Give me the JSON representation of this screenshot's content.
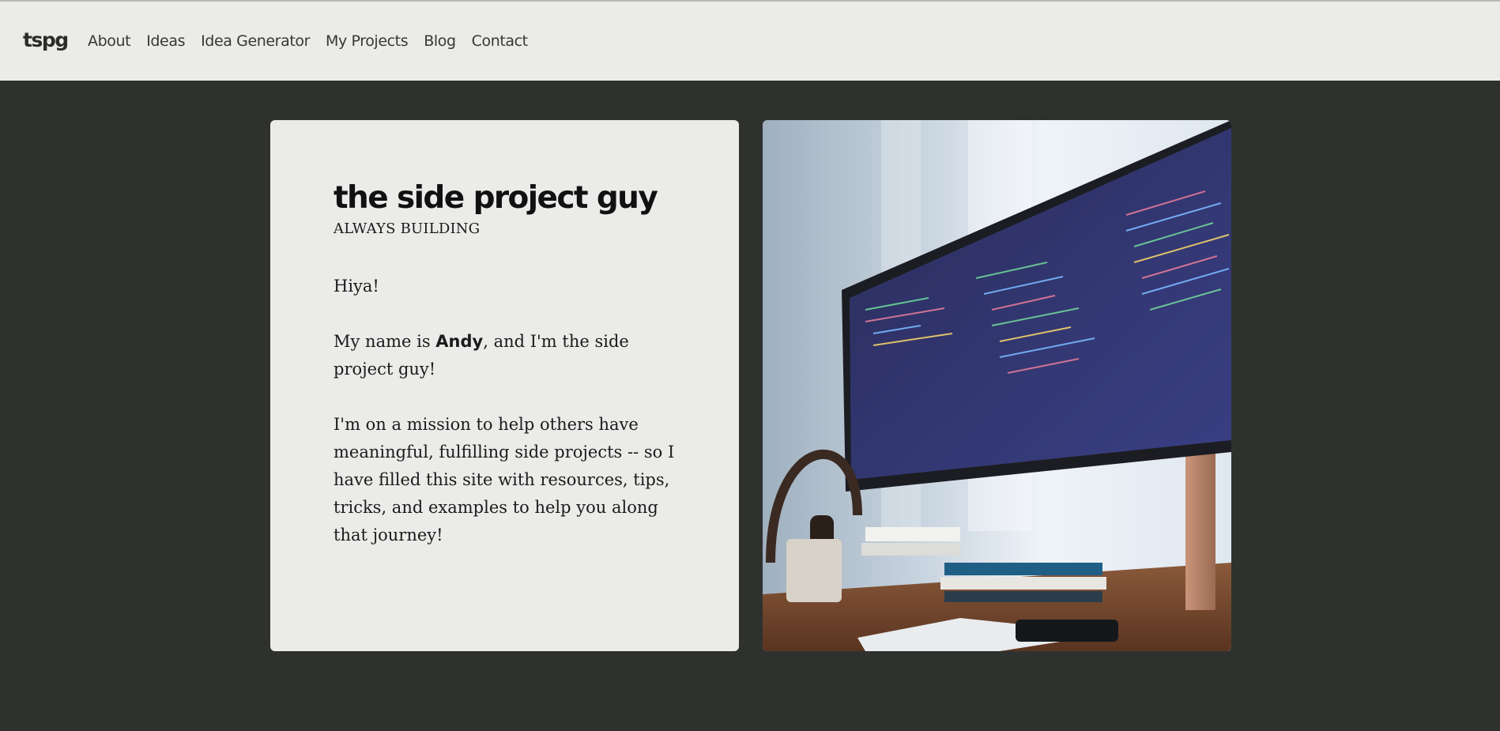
{
  "nav": {
    "brand": "tspg",
    "links": [
      "About",
      "Ideas",
      "Idea Generator",
      "My Projects",
      "Blog",
      "Contact"
    ]
  },
  "hero": {
    "title": "the side project guy",
    "subtitle": "ALWAYS BUILDING",
    "greeting": "Hiya!",
    "intro_prefix": "My name is ",
    "intro_name": "Andy",
    "intro_suffix": ", and I'm the side project guy!",
    "mission": "I'm on a mission to help others have meaningful, fulfilling side projects -- so I have filled this site with resources, tips, tricks, and examples to help you along that journey!"
  },
  "image": {
    "subject": "desk-monitor-photo"
  },
  "colors": {
    "page_bg": "#2f312f",
    "navbar_bg": "#ebebe9",
    "card_bg": "#ebebe9",
    "text": "#1b1b1b"
  }
}
